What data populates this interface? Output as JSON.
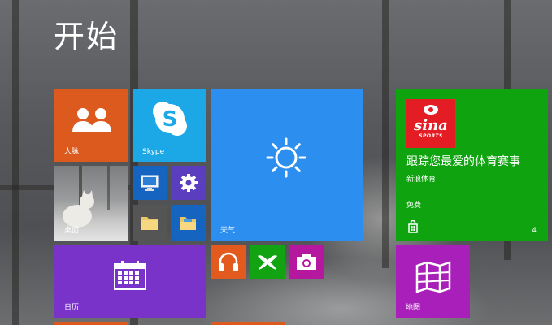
{
  "screen": {
    "title": "开始"
  },
  "tiles": {
    "people": {
      "label": "人脉",
      "color": "#dc5a1e",
      "icon": "people-icon"
    },
    "skype": {
      "label": "Skype",
      "color": "#1ca7e6",
      "icon": "skype-icon"
    },
    "weather": {
      "label": "天气",
      "color": "#2c8fef",
      "icon": "sun-icon"
    },
    "desktop": {
      "label": "桌面",
      "icon": "desktop-wallpaper-thumbnail"
    },
    "small_tiles": [
      {
        "icon": "computer-icon",
        "color": "#1565c0"
      },
      {
        "icon": "gear-icon",
        "color": "#5a3ebf"
      },
      {
        "icon": "folder-icon",
        "color": "#555555"
      },
      {
        "icon": "file-explorer-icon",
        "color": "#1565c0"
      }
    ],
    "sina": {
      "logo_text": "sina",
      "logo_subtext": "SPORTS",
      "headline": "跟踪您最爱的体育赛事",
      "source": "新浪体育",
      "price": "免费",
      "rating": "4",
      "color": "#0fa40f",
      "icon": "store-icon"
    },
    "calendar": {
      "label": "日历",
      "color": "#7a33c9",
      "icon": "calendar-icon"
    },
    "music": {
      "color": "#e25a1d",
      "icon": "headphones-icon"
    },
    "xbox": {
      "color": "#11a311",
      "icon": "xbox-icon"
    },
    "camera": {
      "color": "#b5179e",
      "icon": "camera-icon"
    },
    "maps": {
      "label": "地图",
      "color": "#a81fb9",
      "icon": "map-icon"
    }
  }
}
